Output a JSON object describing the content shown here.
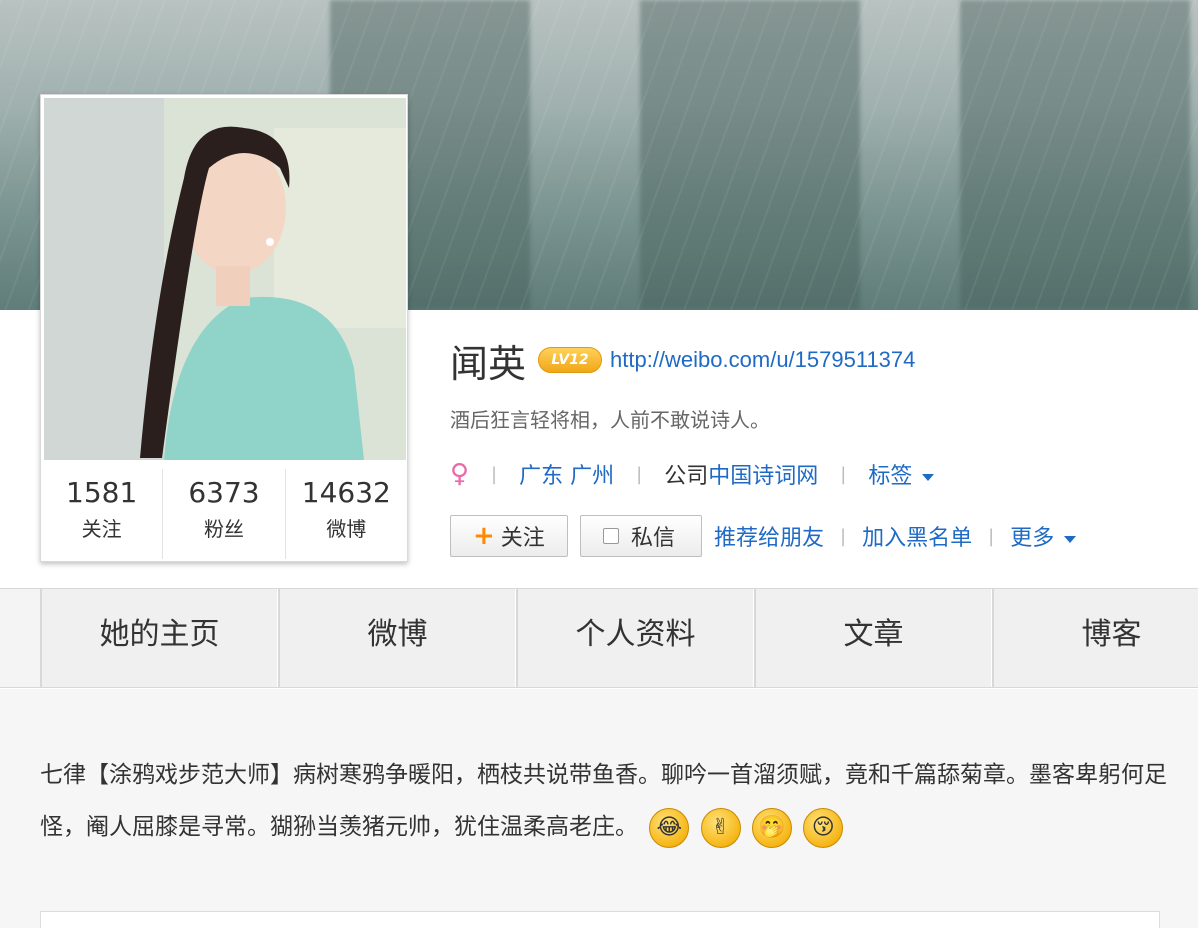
{
  "profile": {
    "name": "闻英",
    "level_badge": "LV12",
    "url": "http://weibo.com/u/1579511374",
    "bio": "酒后狂言轻将相，人前不敢说诗人。",
    "gender_icon": "♀",
    "location": "广东 广州",
    "company_prefix": "公司",
    "company_name": "中国诗词网",
    "tags_label": "标签"
  },
  "stats": [
    {
      "value": "1581",
      "label": "关注"
    },
    {
      "value": "6373",
      "label": "粉丝"
    },
    {
      "value": "14632",
      "label": "微博"
    }
  ],
  "actions": {
    "follow": "关注",
    "message": "私信",
    "recommend": "推荐给朋友",
    "blacklist": "加入黑名单",
    "more": "更多"
  },
  "tabs": [
    "她的主页",
    "微博",
    "个人资料",
    "文章",
    "博客"
  ],
  "post": {
    "text": "七律【涂鸦戏步范大师】病树寒鸦争暖阳，栖枝共说带鱼香。聊吟一首溜须赋，竟和千篇舔菊章。墨客卑躬何足怪，阉人屈膝是寻常。猢狲当羡猪元帅，犹住温柔高老庄。",
    "emoticons": [
      "😂",
      "✌",
      "🤭",
      "😚"
    ]
  },
  "colors": {
    "link": "#1f6ac4",
    "level_badge": "#f1a716",
    "follow_plus": "#ff8a00",
    "gender": "#e86aa8"
  }
}
